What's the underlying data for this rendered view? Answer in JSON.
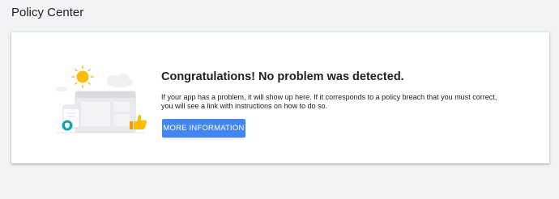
{
  "page": {
    "title": "Policy Center"
  },
  "status_card": {
    "headline": "Congratulations! No problem was detected.",
    "description": "If your app has a problem, it will show up here. If it corresponds to a policy breach that you must correct, you will see a link with instructions on how to do so.",
    "button_label": "MORE INFORMATION"
  },
  "colors": {
    "background": "#f1f3f4",
    "card": "#ffffff",
    "accent": "#4285f4",
    "sun": "#fbbc04",
    "badge": "#12a4af",
    "illustration_gray": "#dadce0"
  },
  "icons": [
    "sun-icon",
    "shield-badge-icon",
    "thumbs-up-icon"
  ]
}
